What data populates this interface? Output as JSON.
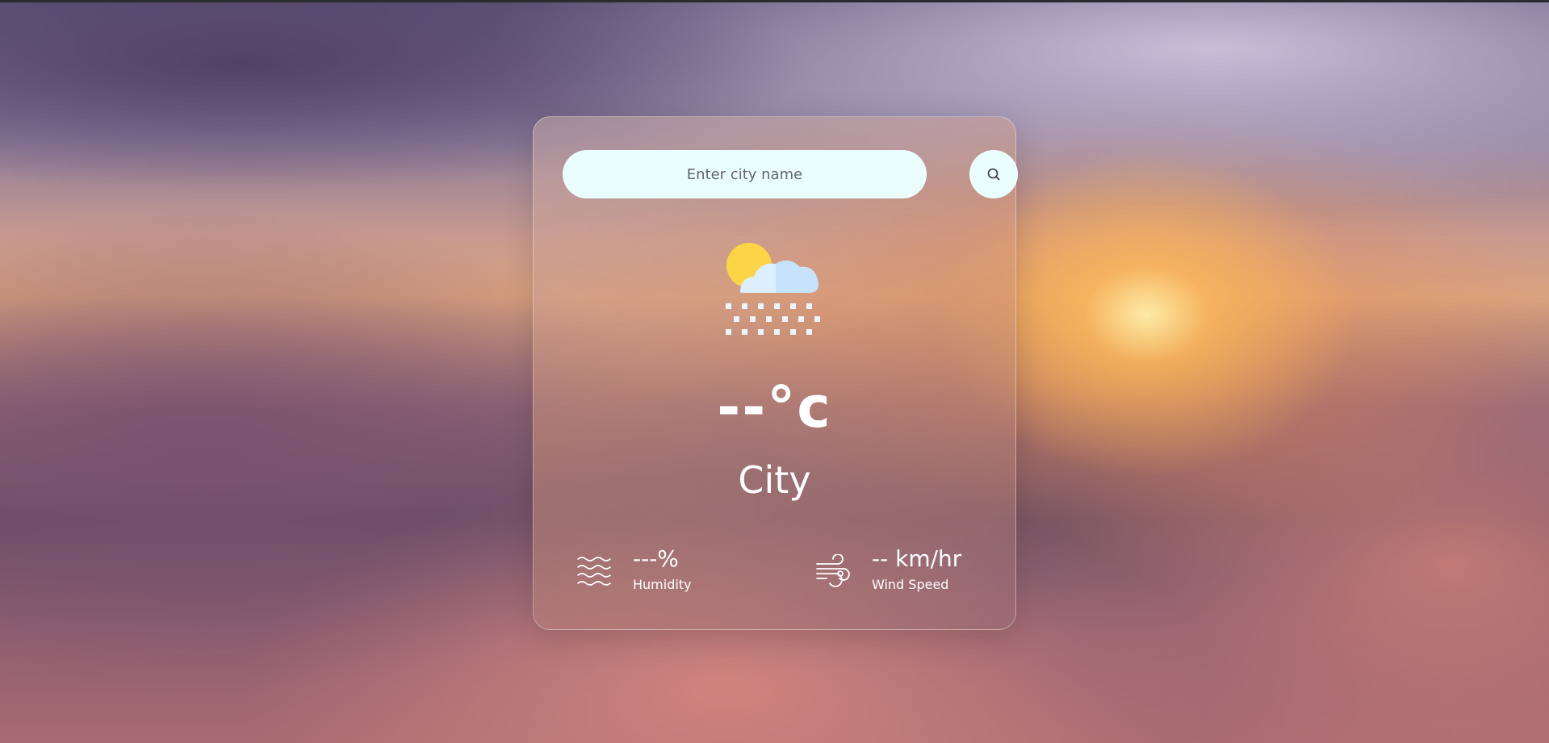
{
  "search": {
    "placeholder": "Enter city name"
  },
  "weather": {
    "icon": "snow-icon",
    "temperature": "--°c",
    "city": "City"
  },
  "humidity": {
    "icon": "humidity-icon",
    "value": "---%",
    "label": "Humidity"
  },
  "wind": {
    "icon": "wind-icon",
    "value": "-- km/hr",
    "label": "Wind Speed"
  },
  "colors": {
    "input_bg": "#ebfefe",
    "sun": "#fbd545",
    "cloud": "#dcefff"
  }
}
